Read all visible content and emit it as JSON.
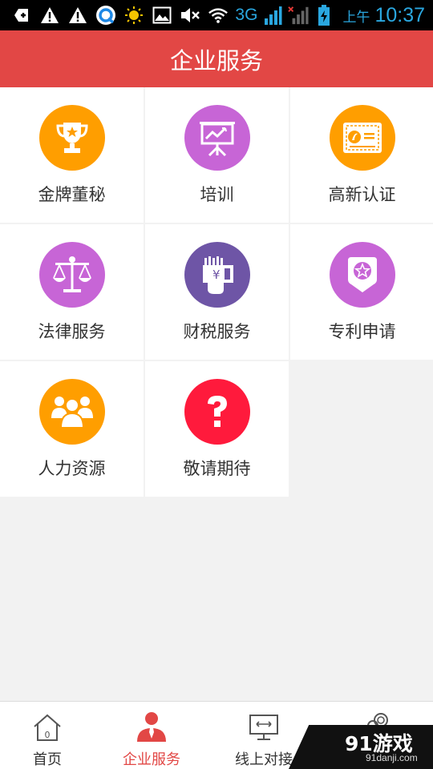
{
  "status_bar": {
    "network": "3G",
    "ampm": "上午",
    "time": "10:37",
    "icons": [
      "usb-icon",
      "warning-icon",
      "warning-icon",
      "browser-icon",
      "brightness-icon",
      "gallery-icon",
      "mute-icon",
      "wifi-icon",
      "signal-icon",
      "no-signal-icon",
      "battery-charging-icon"
    ]
  },
  "header": {
    "title": "企业服务"
  },
  "services": [
    {
      "label": "金牌董秘",
      "icon": "trophy-icon",
      "color": "#ff9e00"
    },
    {
      "label": "培训",
      "icon": "presentation-icon",
      "color": "#c765d6"
    },
    {
      "label": "高新认证",
      "icon": "certificate-icon",
      "color": "#ff9e00"
    },
    {
      "label": "法律服务",
      "icon": "scales-icon",
      "color": "#c765d6"
    },
    {
      "label": "财税服务",
      "icon": "finance-icon",
      "color": "#6e55a6"
    },
    {
      "label": "专利申请",
      "icon": "patent-badge-icon",
      "color": "#c765d6"
    },
    {
      "label": "人力资源",
      "icon": "people-icon",
      "color": "#ff9e00"
    },
    {
      "label": "敬请期待",
      "icon": "question-icon",
      "color": "#ff1a3c"
    }
  ],
  "bottom_nav": {
    "items": [
      {
        "label": "首页",
        "icon": "home-icon"
      },
      {
        "label": "企业服务",
        "icon": "business-person-icon",
        "active": true
      },
      {
        "label": "线上对接",
        "icon": "monitor-icon"
      },
      {
        "label": "",
        "icon": "gears-icon"
      }
    ],
    "active_color": "#e24745"
  },
  "watermark": {
    "logo": "91游戏",
    "url": "91danji.com"
  }
}
